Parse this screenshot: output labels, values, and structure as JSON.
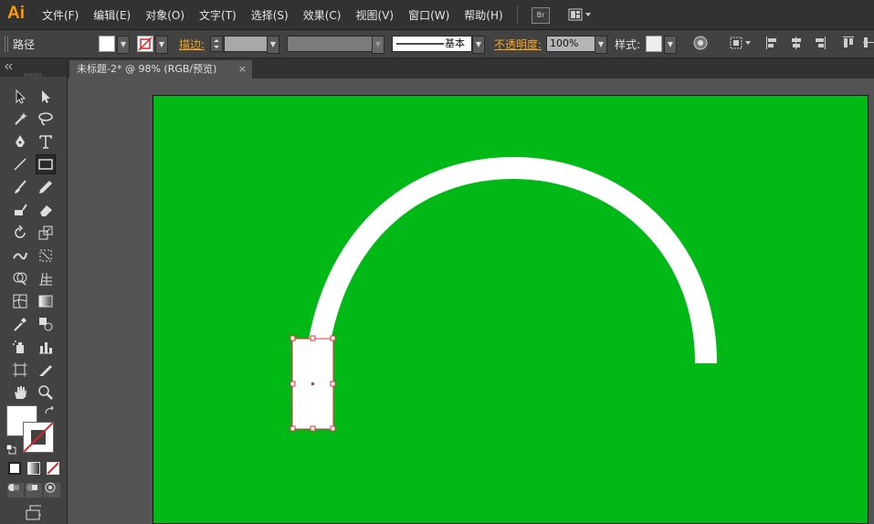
{
  "app": {
    "logo": "Ai"
  },
  "menu": [
    "文件(F)",
    "编辑(E)",
    "对象(O)",
    "文字(T)",
    "选择(S)",
    "效果(C)",
    "视图(V)",
    "窗口(W)",
    "帮助(H)"
  ],
  "bridge_label": "Br",
  "control": {
    "selection_type": "路径",
    "stroke_label": "描边:",
    "stroke_style": "基本",
    "opacity_label": "不透明度:",
    "opacity_value": "100%",
    "style_label": "样式:"
  },
  "document_tab": {
    "title": "未标题-2* @ 98% (RGB/预览)",
    "close": "×"
  },
  "colors": {
    "artboard": "#00b916",
    "arc": "#ffffff",
    "selection": "#e0303a",
    "accent": "#ff9a00"
  }
}
